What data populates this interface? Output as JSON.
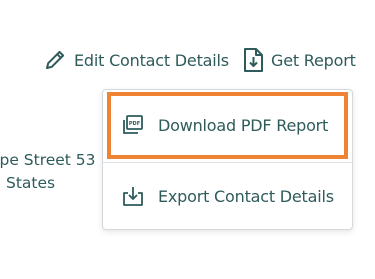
{
  "toolbar": {
    "edit_label": "Edit Contact Details",
    "report_label": "Get Report"
  },
  "address": {
    "line1": "ope Street 53",
    "line2": "States"
  },
  "menu": {
    "items": [
      {
        "label": "Download PDF Report",
        "icon": "pdf-icon"
      },
      {
        "label": "Export Contact Details",
        "icon": "export-icon"
      }
    ]
  },
  "colors": {
    "text": "#2f5b5b",
    "highlight": "#ee8433",
    "border": "#d3d9dc"
  }
}
